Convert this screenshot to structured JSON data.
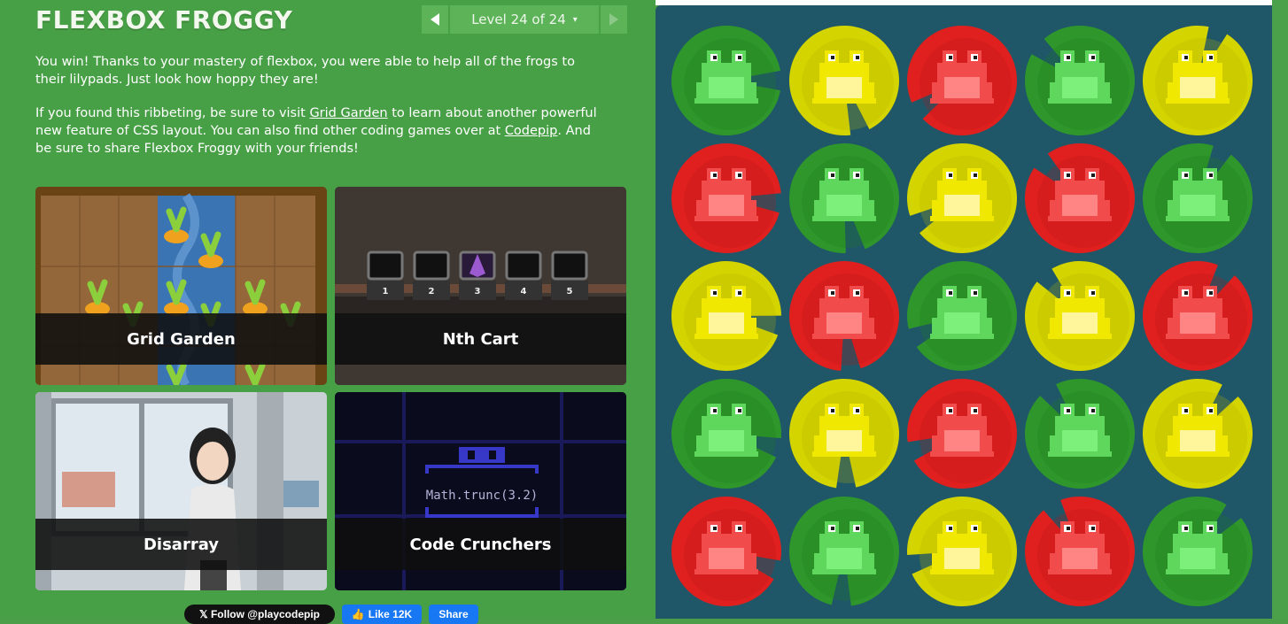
{
  "header": {
    "title": "FLEXBOX FROGGY",
    "level_label": "Level 24 of 24",
    "caret": "▾"
  },
  "win_text": {
    "p1": "You win! Thanks to your mastery of flexbox, you were able to help all of the frogs to their lilypads. Just look how hoppy they are!",
    "p2_a": "If you found this ribbeting, be sure to visit ",
    "p2_link1": "Grid Garden",
    "p2_b": " to learn about another powerful new feature of CSS layout. You can also find other coding games over at ",
    "p2_link2": "Codepip",
    "p2_c": ". And be sure to share Flexbox Froggy with your friends!"
  },
  "games": [
    {
      "label": "Grid Garden"
    },
    {
      "label": "Nth Cart"
    },
    {
      "label": "Disarray"
    },
    {
      "label": "Code Crunchers"
    }
  ],
  "nth_cart": {
    "cart_numbers": [
      "1",
      "2",
      "3",
      "4",
      "5"
    ]
  },
  "code_crunchers": {
    "code": "Math.trunc(3.2)"
  },
  "social": {
    "follow": "𝕏 Follow @playcodepip",
    "like": "Like 12K",
    "share": "Share"
  },
  "colors": {
    "green": "#2f9a2f",
    "red": "#e02020",
    "yellow": "#d8d800",
    "board": "#1f5768",
    "panel": "#48a046"
  },
  "board": {
    "rows": [
      [
        "green",
        "yellow",
        "red",
        "green",
        "yellow"
      ],
      [
        "red",
        "green",
        "yellow",
        "red",
        "green"
      ],
      [
        "yellow",
        "red",
        "green",
        "yellow",
        "red"
      ],
      [
        "green",
        "yellow",
        "red",
        "green",
        "yellow"
      ],
      [
        "red",
        "green",
        "yellow",
        "red",
        "green"
      ]
    ]
  }
}
